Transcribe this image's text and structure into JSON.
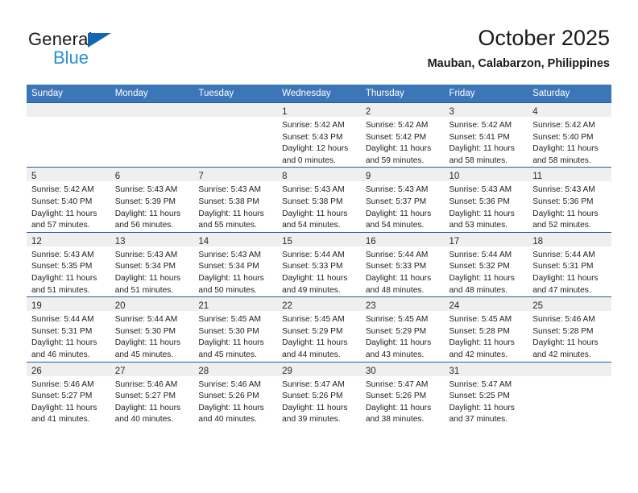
{
  "logo": {
    "word1": "General",
    "word2": "Blue",
    "triangle_icon": "blue-triangle-icon",
    "color_dark": "#1267b2",
    "color_light": "#2b8fd4"
  },
  "header": {
    "title": "October 2025",
    "subtitle": "Mauban, Calabarzon, Philippines"
  },
  "theme": {
    "header_bg": "#3b76b9",
    "row_border": "#1a5fa4",
    "daynum_bg": "#efefef"
  },
  "weekdays": [
    "Sunday",
    "Monday",
    "Tuesday",
    "Wednesday",
    "Thursday",
    "Friday",
    "Saturday"
  ],
  "weeks": [
    [
      {
        "day": "",
        "lines": []
      },
      {
        "day": "",
        "lines": []
      },
      {
        "day": "",
        "lines": []
      },
      {
        "day": "1",
        "lines": [
          "Sunrise: 5:42 AM",
          "Sunset: 5:43 PM",
          "Daylight: 12 hours",
          "and 0 minutes."
        ]
      },
      {
        "day": "2",
        "lines": [
          "Sunrise: 5:42 AM",
          "Sunset: 5:42 PM",
          "Daylight: 11 hours",
          "and 59 minutes."
        ]
      },
      {
        "day": "3",
        "lines": [
          "Sunrise: 5:42 AM",
          "Sunset: 5:41 PM",
          "Daylight: 11 hours",
          "and 58 minutes."
        ]
      },
      {
        "day": "4",
        "lines": [
          "Sunrise: 5:42 AM",
          "Sunset: 5:40 PM",
          "Daylight: 11 hours",
          "and 58 minutes."
        ]
      }
    ],
    [
      {
        "day": "5",
        "lines": [
          "Sunrise: 5:42 AM",
          "Sunset: 5:40 PM",
          "Daylight: 11 hours",
          "and 57 minutes."
        ]
      },
      {
        "day": "6",
        "lines": [
          "Sunrise: 5:43 AM",
          "Sunset: 5:39 PM",
          "Daylight: 11 hours",
          "and 56 minutes."
        ]
      },
      {
        "day": "7",
        "lines": [
          "Sunrise: 5:43 AM",
          "Sunset: 5:38 PM",
          "Daylight: 11 hours",
          "and 55 minutes."
        ]
      },
      {
        "day": "8",
        "lines": [
          "Sunrise: 5:43 AM",
          "Sunset: 5:38 PM",
          "Daylight: 11 hours",
          "and 54 minutes."
        ]
      },
      {
        "day": "9",
        "lines": [
          "Sunrise: 5:43 AM",
          "Sunset: 5:37 PM",
          "Daylight: 11 hours",
          "and 54 minutes."
        ]
      },
      {
        "day": "10",
        "lines": [
          "Sunrise: 5:43 AM",
          "Sunset: 5:36 PM",
          "Daylight: 11 hours",
          "and 53 minutes."
        ]
      },
      {
        "day": "11",
        "lines": [
          "Sunrise: 5:43 AM",
          "Sunset: 5:36 PM",
          "Daylight: 11 hours",
          "and 52 minutes."
        ]
      }
    ],
    [
      {
        "day": "12",
        "lines": [
          "Sunrise: 5:43 AM",
          "Sunset: 5:35 PM",
          "Daylight: 11 hours",
          "and 51 minutes."
        ]
      },
      {
        "day": "13",
        "lines": [
          "Sunrise: 5:43 AM",
          "Sunset: 5:34 PM",
          "Daylight: 11 hours",
          "and 51 minutes."
        ]
      },
      {
        "day": "14",
        "lines": [
          "Sunrise: 5:43 AM",
          "Sunset: 5:34 PM",
          "Daylight: 11 hours",
          "and 50 minutes."
        ]
      },
      {
        "day": "15",
        "lines": [
          "Sunrise: 5:44 AM",
          "Sunset: 5:33 PM",
          "Daylight: 11 hours",
          "and 49 minutes."
        ]
      },
      {
        "day": "16",
        "lines": [
          "Sunrise: 5:44 AM",
          "Sunset: 5:33 PM",
          "Daylight: 11 hours",
          "and 48 minutes."
        ]
      },
      {
        "day": "17",
        "lines": [
          "Sunrise: 5:44 AM",
          "Sunset: 5:32 PM",
          "Daylight: 11 hours",
          "and 48 minutes."
        ]
      },
      {
        "day": "18",
        "lines": [
          "Sunrise: 5:44 AM",
          "Sunset: 5:31 PM",
          "Daylight: 11 hours",
          "and 47 minutes."
        ]
      }
    ],
    [
      {
        "day": "19",
        "lines": [
          "Sunrise: 5:44 AM",
          "Sunset: 5:31 PM",
          "Daylight: 11 hours",
          "and 46 minutes."
        ]
      },
      {
        "day": "20",
        "lines": [
          "Sunrise: 5:44 AM",
          "Sunset: 5:30 PM",
          "Daylight: 11 hours",
          "and 45 minutes."
        ]
      },
      {
        "day": "21",
        "lines": [
          "Sunrise: 5:45 AM",
          "Sunset: 5:30 PM",
          "Daylight: 11 hours",
          "and 45 minutes."
        ]
      },
      {
        "day": "22",
        "lines": [
          "Sunrise: 5:45 AM",
          "Sunset: 5:29 PM",
          "Daylight: 11 hours",
          "and 44 minutes."
        ]
      },
      {
        "day": "23",
        "lines": [
          "Sunrise: 5:45 AM",
          "Sunset: 5:29 PM",
          "Daylight: 11 hours",
          "and 43 minutes."
        ]
      },
      {
        "day": "24",
        "lines": [
          "Sunrise: 5:45 AM",
          "Sunset: 5:28 PM",
          "Daylight: 11 hours",
          "and 42 minutes."
        ]
      },
      {
        "day": "25",
        "lines": [
          "Sunrise: 5:46 AM",
          "Sunset: 5:28 PM",
          "Daylight: 11 hours",
          "and 42 minutes."
        ]
      }
    ],
    [
      {
        "day": "26",
        "lines": [
          "Sunrise: 5:46 AM",
          "Sunset: 5:27 PM",
          "Daylight: 11 hours",
          "and 41 minutes."
        ]
      },
      {
        "day": "27",
        "lines": [
          "Sunrise: 5:46 AM",
          "Sunset: 5:27 PM",
          "Daylight: 11 hours",
          "and 40 minutes."
        ]
      },
      {
        "day": "28",
        "lines": [
          "Sunrise: 5:46 AM",
          "Sunset: 5:26 PM",
          "Daylight: 11 hours",
          "and 40 minutes."
        ]
      },
      {
        "day": "29",
        "lines": [
          "Sunrise: 5:47 AM",
          "Sunset: 5:26 PM",
          "Daylight: 11 hours",
          "and 39 minutes."
        ]
      },
      {
        "day": "30",
        "lines": [
          "Sunrise: 5:47 AM",
          "Sunset: 5:26 PM",
          "Daylight: 11 hours",
          "and 38 minutes."
        ]
      },
      {
        "day": "31",
        "lines": [
          "Sunrise: 5:47 AM",
          "Sunset: 5:25 PM",
          "Daylight: 11 hours",
          "and 37 minutes."
        ]
      },
      {
        "day": "",
        "lines": []
      }
    ]
  ]
}
